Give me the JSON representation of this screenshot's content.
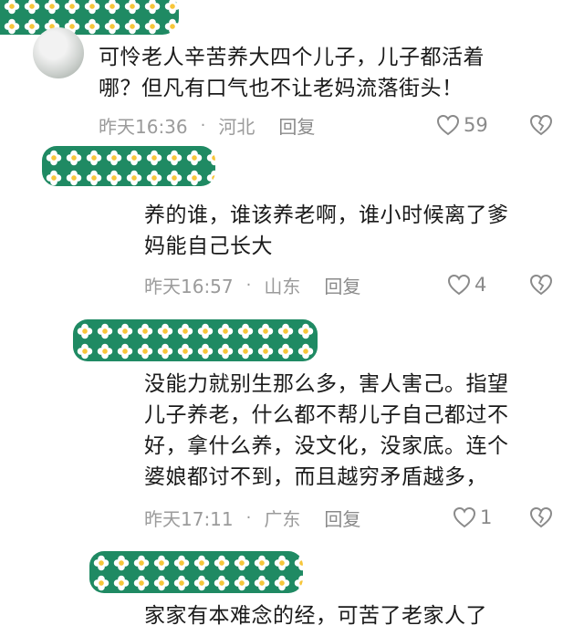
{
  "colors": {
    "username_bar_green": "#1f8a63",
    "flower_petal": "#ffffff",
    "flower_center": "#f7c63a",
    "meta_gray": "#9b9b9b"
  },
  "comments": [
    {
      "text_lines": [
        "可怜老人辛苦养大四个儿子，儿子都活着",
        "哪？但凡有口气也不让老妈流落街头！"
      ],
      "time": "昨天16:36",
      "location": "河北",
      "reply_label": "回复",
      "likes": "59"
    },
    {
      "text_lines": [
        "养的谁，谁该养老啊，谁小时候离了爹",
        "妈能自己长大"
      ],
      "time": "昨天16:57",
      "location": "山东",
      "reply_label": "回复",
      "likes": "4"
    },
    {
      "text_lines": [
        "没能力就别生那么多，害人害己。指望",
        "儿子养老，什么都不帮儿子自己都过不",
        "好，拿什么养，没文化，没家底。连个",
        "婆娘都讨不到，而且越穷矛盾越多，"
      ],
      "time": "昨天17:11",
      "location": "广东",
      "reply_label": "回复",
      "likes": "1"
    },
    {
      "text_lines": [
        "家家有本难念的经，可苦了老家人了"
      ]
    }
  ],
  "separator_dot": "·",
  "icons": {
    "like": "heart-outline-icon",
    "dislike": "broken-heart-icon",
    "avatar": "user-avatar"
  }
}
